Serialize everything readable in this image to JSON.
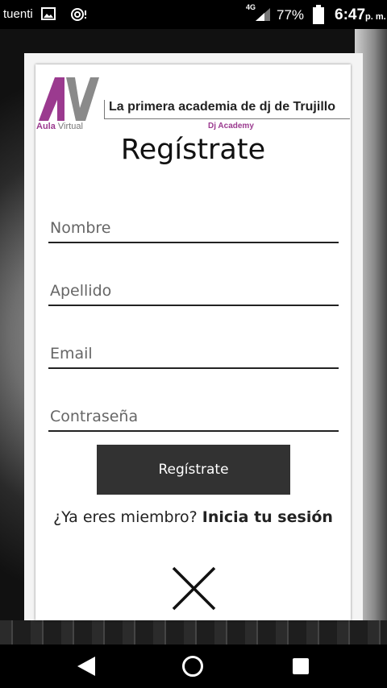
{
  "status_bar": {
    "carrier": "tuenti",
    "network": "4G",
    "battery": "77%",
    "time": "6:47",
    "ampm": "p. m."
  },
  "header": {
    "logo_word_1": "Aula",
    "logo_word_2": "Virtual",
    "tagline": "La primera academia de dj de Trujillo",
    "sub_tagline": "Dj Academy"
  },
  "form": {
    "title": "Regístrate",
    "fields": [
      {
        "placeholder": "Nombre"
      },
      {
        "placeholder": "Apellido"
      },
      {
        "placeholder": "Email"
      },
      {
        "placeholder": "Contraseña"
      }
    ],
    "submit_label": "Regístrate",
    "member_prompt": "¿Ya eres miembro?",
    "login_link": "Inicia tu sesión"
  },
  "icons": {
    "close": "close-icon",
    "nav_back": "back-icon",
    "nav_home": "home-icon",
    "nav_recent": "recent-apps-icon"
  },
  "colors": {
    "brand_purple": "#9b3a8f",
    "button_bg": "#323232"
  }
}
